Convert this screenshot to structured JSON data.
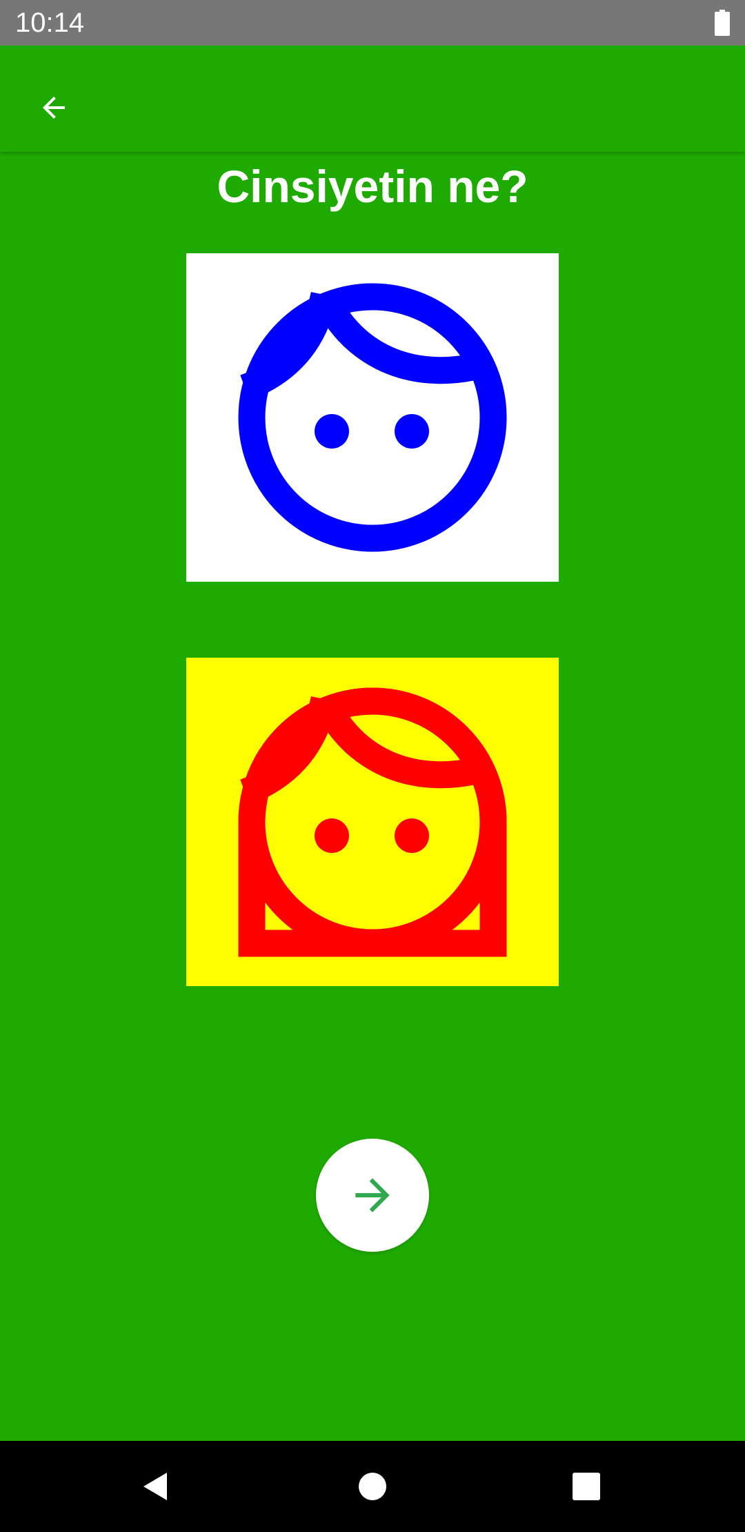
{
  "status_bar": {
    "time": "10:14",
    "battery_icon": "battery-full-icon"
  },
  "app_bar": {
    "back_icon": "arrow-back-icon"
  },
  "page": {
    "title": "Cinsiyetin ne?"
  },
  "options": [
    {
      "id": "male",
      "icon": "boy-face-icon",
      "background": "#ffffff",
      "stroke": "#0000ff"
    },
    {
      "id": "female",
      "icon": "girl-face-icon",
      "background": "#ffff00",
      "stroke": "#ff0000"
    }
  ],
  "next_button": {
    "icon": "arrow-forward-icon",
    "icon_color": "#2fa84f"
  },
  "nav_bar": {
    "back_icon": "nav-back-triangle-icon",
    "home_icon": "nav-home-circle-icon",
    "recents_icon": "nav-recents-square-icon"
  },
  "theme": {
    "background": "#1faa00",
    "status_bar": "#777777"
  }
}
